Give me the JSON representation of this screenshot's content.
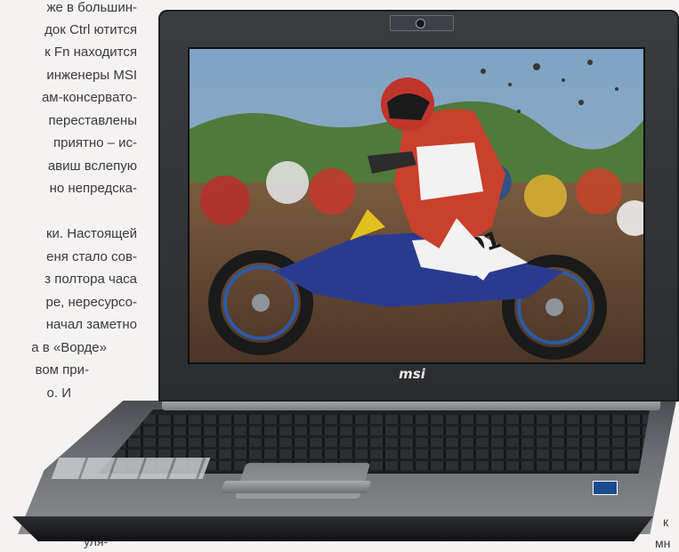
{
  "article_text": {
    "lines": [
      "же в большин-",
      "док Ctrl ютится",
      "к Fn находится",
      "инженеры MSI",
      "ам-консервато-",
      "переставлены",
      "приятно – ис-",
      "авиш вслепую",
      "но непредска-",
      "",
      "ки. Настоящей",
      "еня стало сов-",
      "з полтора часа",
      "ре, нересурсо-",
      "начал заметно",
      "а в «Ворде»",
      "вом при-",
      "о. И"
    ],
    "bottom_left_fragment": "уля-",
    "bottom_right_fragment_1": "к",
    "bottom_right_fragment_2": "мн"
  },
  "laptop": {
    "brand_logo": "msi",
    "screen_image": "motocross-race-photo"
  },
  "colors": {
    "page_background": "#f4f3f1",
    "lid": "#2a2c2e",
    "deck": "#6b6e72",
    "text": "#3a3a3a"
  }
}
